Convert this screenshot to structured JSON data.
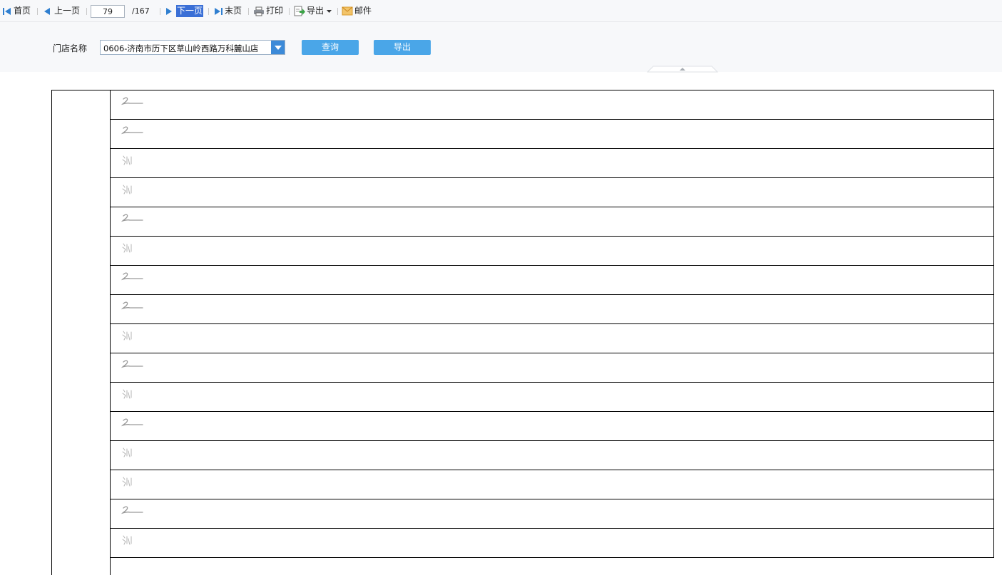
{
  "toolbar": {
    "first": "首页",
    "prev": "上一页",
    "current_page": "79",
    "total": "/167",
    "next": "下一页",
    "last": "末页",
    "print": "打印",
    "export": "导出",
    "mail": "邮件"
  },
  "filter": {
    "store_label": "门店名称",
    "store_value": "0606-济南市历下区草山岭西路万科麓山店",
    "query_button": "查询",
    "export_button": "导出"
  },
  "report": {
    "row_count": 16,
    "rows": [
      "sig-a",
      "sig-a",
      "sig-b",
      "sig-b",
      "sig-a",
      "sig-b",
      "sig-a",
      "sig-a",
      "sig-b",
      "sig-a",
      "sig-b",
      "sig-a",
      "sig-b",
      "sig-b",
      "sig-a",
      "sig-b"
    ]
  },
  "colors": {
    "accent": "#4aa6e8",
    "toolbar_bg": "#f7f8fa",
    "nav_icon": "#2f7fd0"
  }
}
